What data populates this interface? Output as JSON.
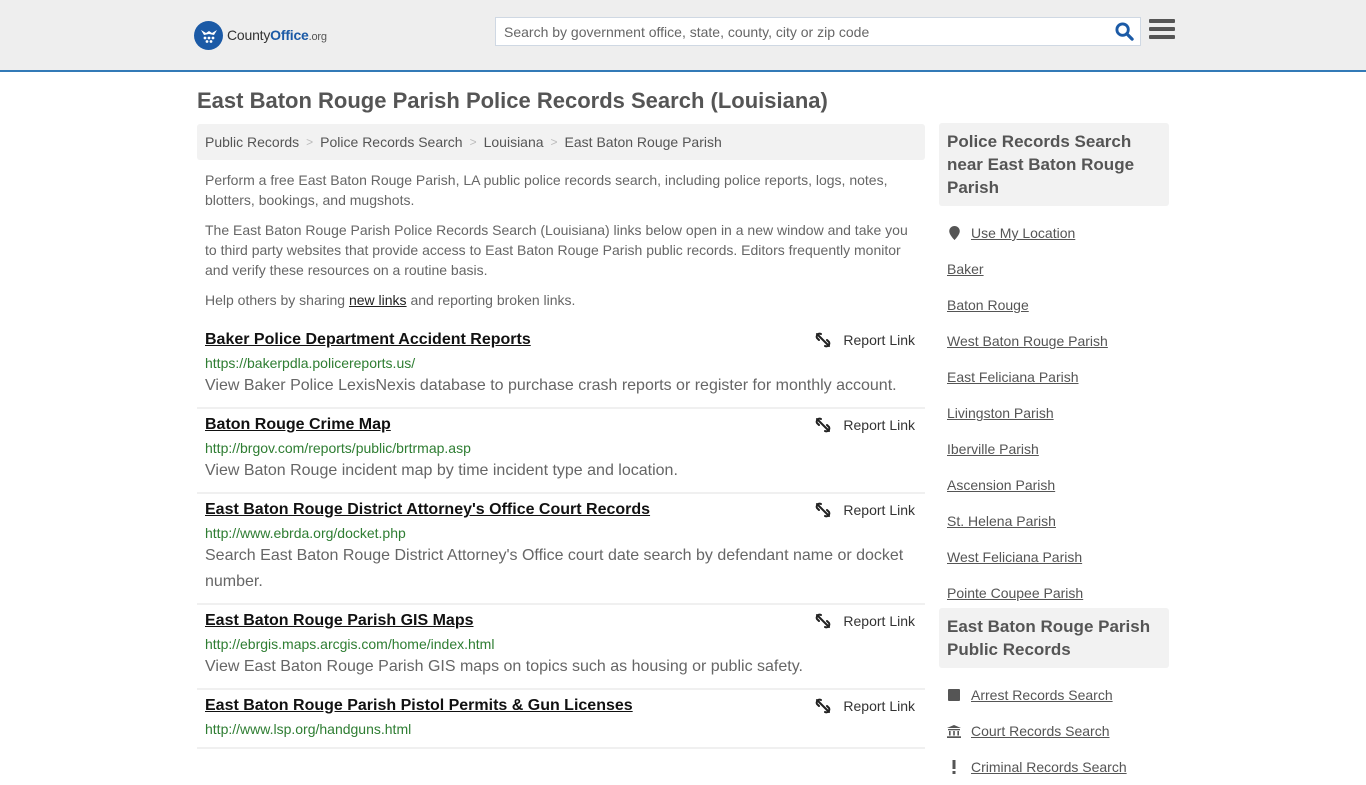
{
  "header": {
    "logo": {
      "county": "County",
      "office": "Office",
      "org": ".org"
    },
    "search": {
      "placeholder": "Search by government office, state, county, city or zip code",
      "value": ""
    },
    "colors": {
      "brand": "#1b5aa6",
      "accent_border": "#337ab7"
    }
  },
  "page": {
    "title": "East Baton Rouge Parish Police Records Search (Louisiana)"
  },
  "breadcrumb": [
    "Public Records",
    "Police Records Search",
    "Louisiana",
    "East Baton Rouge Parish"
  ],
  "intro": {
    "p1": "Perform a free East Baton Rouge Parish, LA public police records search, including police reports, logs, notes, blotters, bookings, and mugshots.",
    "p2": "The East Baton Rouge Parish Police Records Search (Louisiana) links below open in a new window and take you to third party websites that provide access to East Baton Rouge Parish public records. Editors frequently monitor and verify these resources on a routine basis.",
    "p3_before": "Help others by sharing ",
    "p3_link": "new links",
    "p3_after": " and reporting broken links."
  },
  "report_label": "Report Link",
  "results": [
    {
      "title": "Baker Police Department Accident Reports",
      "url": "https://bakerpdla.policereports.us/",
      "desc": "View Baker Police LexisNexis database to purchase crash reports or register for monthly account."
    },
    {
      "title": "Baton Rouge Crime Map",
      "url": "http://brgov.com/reports/public/brtrmap.asp",
      "desc": "View Baton Rouge incident map by time incident type and location."
    },
    {
      "title": "East Baton Rouge District Attorney's Office Court Records",
      "url": "http://www.ebrda.org/docket.php",
      "desc": "Search East Baton Rouge District Attorney's Office court date search by defendant name or docket number."
    },
    {
      "title": "East Baton Rouge Parish GIS Maps",
      "url": "http://ebrgis.maps.arcgis.com/home/index.html",
      "desc": "View East Baton Rouge Parish GIS maps on topics such as housing or public safety."
    },
    {
      "title": "East Baton Rouge Parish Pistol Permits & Gun Licenses",
      "url": "http://www.lsp.org/handguns.html",
      "desc": ""
    }
  ],
  "sidebar": {
    "nearby": {
      "heading": "Police Records Search near East Baton Rouge Parish",
      "use_location": "Use My Location",
      "items": [
        "Baker",
        "Baton Rouge",
        "West Baton Rouge Parish",
        "East Feliciana Parish",
        "Livingston Parish",
        "Iberville Parish",
        "Ascension Parish",
        "St. Helena Parish",
        "West Feliciana Parish",
        "Pointe Coupee Parish"
      ]
    },
    "public_records": {
      "heading": "East Baton Rouge Parish Public Records",
      "items": [
        {
          "label": "Arrest Records Search",
          "icon": "square-icon"
        },
        {
          "label": "Court Records Search",
          "icon": "courthouse-icon"
        },
        {
          "label": "Criminal Records Search",
          "icon": "exclamation-icon"
        }
      ]
    }
  }
}
